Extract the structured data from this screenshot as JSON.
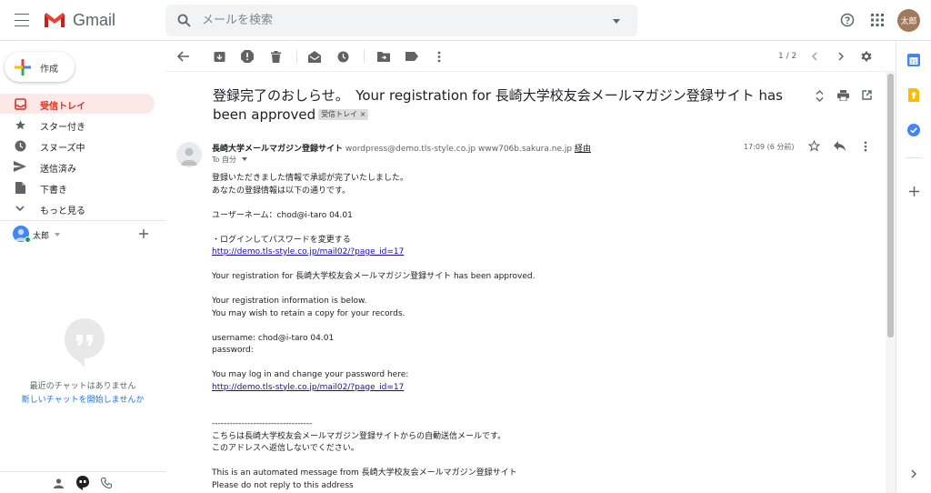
{
  "app": {
    "name": "Gmail"
  },
  "search": {
    "placeholder": "メールを検索"
  },
  "account": {
    "avatar_text": "太郎"
  },
  "compose": {
    "label": "作成"
  },
  "nav": [
    {
      "label": "受信トレイ",
      "icon": "inbox-icon",
      "active": true
    },
    {
      "label": "スター付き",
      "icon": "star-icon"
    },
    {
      "label": "スヌーズ中",
      "icon": "clock-icon"
    },
    {
      "label": "送信済み",
      "icon": "send-icon"
    },
    {
      "label": "下書き",
      "icon": "draft-icon"
    },
    {
      "label": "もっと見る",
      "icon": "chevron-down-icon"
    }
  ],
  "hangouts": {
    "user": "太郎",
    "empty_text": "最近のチャットはありません",
    "start_link": "新しいチャットを開始しませんか"
  },
  "toolbar": {
    "page_count": "1 / 2"
  },
  "email": {
    "subject": "登録完了のおしらせ。　Your registration for 長崎大学校友会メールマガジン登録サイト has been approved",
    "label": "受信トレイ",
    "label_close": "×",
    "sender_name": "長崎大学メールマガジン登録サイト",
    "sender_address": "wordpress@demo.tls-style.co.jp www706b.sakura.ne.jp",
    "via": "経由",
    "to": "To 自分",
    "time": "17:09 (6 分前)",
    "body": {
      "l1": "登録いただきました情報で承認が完了いたしました。",
      "l2": "あなたの登録情報は以下の通りです。",
      "l3": "ユーザーネーム：chod@i-taro 04.01",
      "l4": "・ログインしてパスワードを変更する",
      "link1": "http://demo.tls-style.co.jp/mail02/?page_id=17",
      "l5": "Your registration for 長崎大学校友会メールマガジン登録サイト has been approved.",
      "l6": "Your registration information is below.",
      "l7": "You may wish to retain a copy for your records.",
      "l8": "username: chod@i-taro 04.01",
      "l9": "password:",
      "l10": "You may log in and change your password here:",
      "link2": "http://demo.tls-style.co.jp/mail02/?page_id=17",
      "sep": "----------------------------------",
      "l11": "こちらは長崎大学校友会メールマガジン登録サイトからの自動送信メールです。",
      "l12": "このアドレスへ返信しないでください。",
      "l13": "This is an automated message from 長崎大学校友会メールマガジン登録サイト",
      "l14": "Please do not reply to this address"
    }
  },
  "colors": {
    "accent_red": "#d93025",
    "link_blue": "#1a73e8",
    "active_bg": "#fce8e6"
  }
}
